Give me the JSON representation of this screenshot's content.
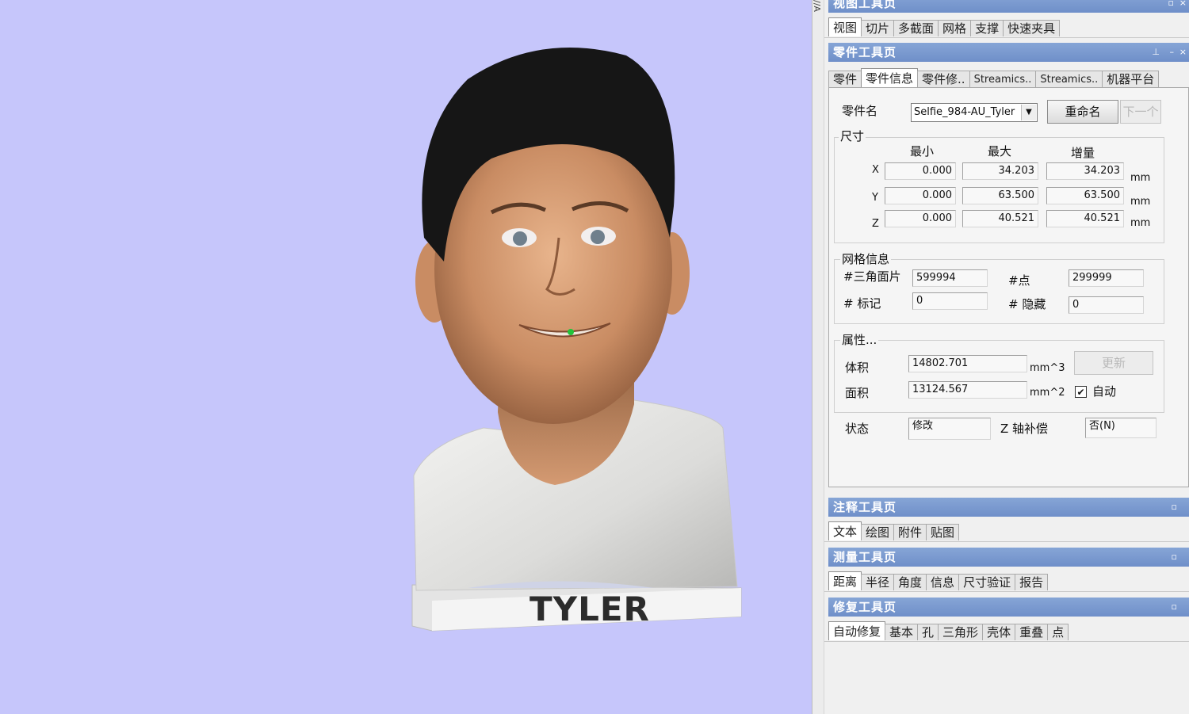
{
  "model": {
    "base_label": "TYLER"
  },
  "panel": {
    "view_toolbar": {
      "title": "视图工具页",
      "tabs": [
        "视图",
        "切片",
        "多截面",
        "网格",
        "支撑",
        "快速夹具"
      ]
    },
    "part_toolbar": {
      "title": "零件工具页",
      "tabs": [
        "零件",
        "零件信息",
        "零件修..",
        "Streamics..",
        "Streamics..",
        "机器平台"
      ],
      "part_name_label": "零件名",
      "part_name_value": "Selfie_984-AU_Tyler",
      "rename_button": "重命名",
      "next_button": "下一个",
      "dimensions": {
        "title": "尺寸",
        "col_min": "最小",
        "col_max": "最大",
        "col_delta": "增量",
        "unit": "mm",
        "rows": [
          {
            "axis": "X",
            "min": "0.000",
            "max": "34.203",
            "delta": "34.203"
          },
          {
            "axis": "Y",
            "min": "0.000",
            "max": "63.500",
            "delta": "63.500"
          },
          {
            "axis": "Z",
            "min": "0.000",
            "max": "40.521",
            "delta": "40.521"
          }
        ]
      },
      "mesh_info": {
        "title": "网格信息",
        "triangles_label": "#三角面片",
        "triangles_value": "599994",
        "points_label": "#点",
        "points_value": "299999",
        "marked_label": "# 标记",
        "marked_value": "0",
        "hidden_label": "# 隐藏",
        "hidden_value": "0"
      },
      "properties": {
        "title": "属性...",
        "volume_label": "体积",
        "volume_value": "14802.701",
        "volume_unit": "mm^3",
        "area_label": "面积",
        "area_value": "13124.567",
        "area_unit": "mm^2",
        "update_button": "更新",
        "auto_label": "自动"
      },
      "status_label": "状态",
      "status_value": "修改",
      "z_comp_label": "Z 轴补偿",
      "z_comp_value": "否(N)"
    },
    "annotation_toolbar": {
      "title": "注释工具页",
      "tabs": [
        "文本",
        "绘图",
        "附件",
        "贴图"
      ]
    },
    "measure_toolbar": {
      "title": "测量工具页",
      "tabs": [
        "距离",
        "半径",
        "角度",
        "信息",
        "尺寸验证",
        "报告"
      ]
    },
    "repair_toolbar": {
      "title": "修复工具页",
      "tabs": [
        "自动修复",
        "基本",
        "孔",
        "三角形",
        "壳体",
        "重叠",
        "点"
      ]
    }
  },
  "colors": {
    "viewport_bg": "#c6c6fb",
    "title_bar": "#7896cf",
    "panel_bg": "#f0f0f0"
  }
}
